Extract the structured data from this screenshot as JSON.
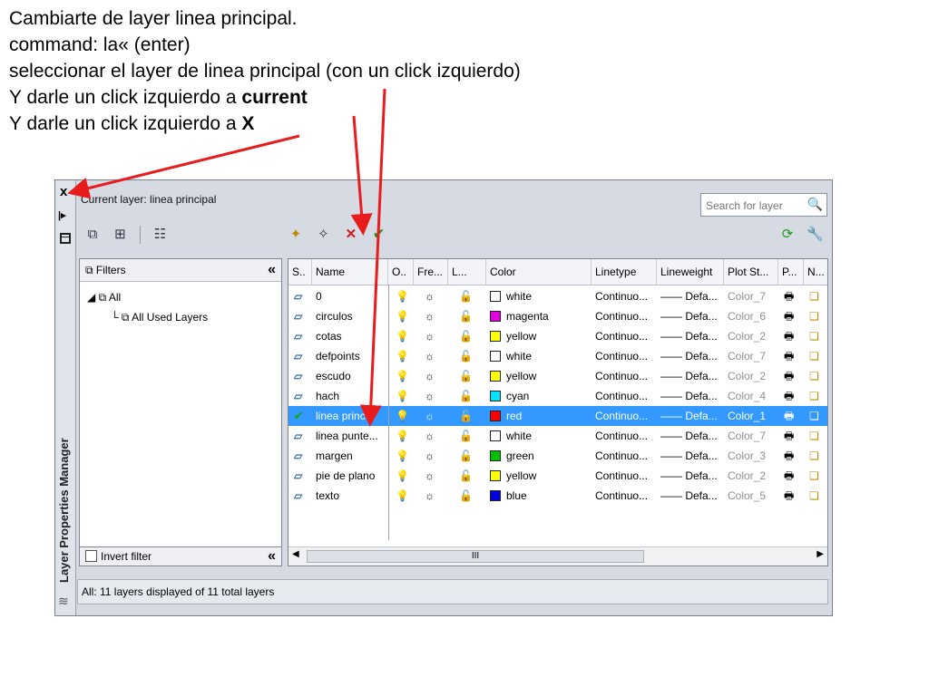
{
  "instructions": {
    "line1": "Cambiarte de layer linea principal.",
    "line2": "command: la« (enter)",
    "line3": "seleccionar el layer de linea principal  (con un click izquierdo)",
    "line4_prefix": "Y darle un click izquierdo a ",
    "line4_bold": "current",
    "line5_prefix": "Y darle un click izquierdo a ",
    "line5_bold": "X"
  },
  "palette": {
    "close_glyph": "x",
    "vertical_title": "Layer Properties Manager",
    "current_layer": "Current layer: linea principal",
    "search_placeholder": "Search for layer",
    "filters_header": "Filters",
    "tree_all": "All",
    "tree_used": "All Used Layers",
    "invert_filter": "Invert filter",
    "status": "All: 11 layers displayed of 11 total layers",
    "scroll_thumb": "III"
  },
  "columns": [
    "S..",
    "Name",
    "O..",
    "Fre...",
    "L...",
    "Color",
    "Linetype",
    "Lineweight",
    "Plot St...",
    "P...",
    "N..."
  ],
  "layers": [
    {
      "name": "0",
      "color": "white",
      "hex": "#ffffff",
      "linetype": "Continuo...",
      "lineweight": "Defa...",
      "plot": "Color_7"
    },
    {
      "name": "circulos",
      "color": "magenta",
      "hex": "#e000e0",
      "linetype": "Continuo...",
      "lineweight": "Defa...",
      "plot": "Color_6"
    },
    {
      "name": "cotas",
      "color": "yellow",
      "hex": "#ffff00",
      "linetype": "Continuo...",
      "lineweight": "Defa...",
      "plot": "Color_2"
    },
    {
      "name": "defpoints",
      "color": "white",
      "hex": "#ffffff",
      "linetype": "Continuo...",
      "lineweight": "Defa...",
      "plot": "Color_7"
    },
    {
      "name": "escudo",
      "color": "yellow",
      "hex": "#ffff00",
      "linetype": "Continuo...",
      "lineweight": "Defa...",
      "plot": "Color_2"
    },
    {
      "name": "hach",
      "color": "cyan",
      "hex": "#00e5ff",
      "linetype": "Continuo...",
      "lineweight": "Defa...",
      "plot": "Color_4"
    },
    {
      "name": "linea princ...",
      "color": "red",
      "hex": "#ff0000",
      "linetype": "Continuo...",
      "lineweight": "Defa...",
      "plot": "Color_1",
      "selected": true,
      "current": true
    },
    {
      "name": "linea punte...",
      "color": "white",
      "hex": "#ffffff",
      "linetype": "Continuo...",
      "lineweight": "Defa...",
      "plot": "Color_7"
    },
    {
      "name": "margen",
      "color": "green",
      "hex": "#00c000",
      "linetype": "Continuo...",
      "lineweight": "Defa...",
      "plot": "Color_3"
    },
    {
      "name": "pie de plano",
      "color": "yellow",
      "hex": "#ffff00",
      "linetype": "Continuo...",
      "lineweight": "Defa...",
      "plot": "Color_2"
    },
    {
      "name": "texto",
      "color": "blue",
      "hex": "#0000e0",
      "linetype": "Continuo...",
      "lineweight": "Defa...",
      "plot": "Color_5"
    }
  ],
  "colors": {
    "selection": "#3399ff",
    "arrow": "#e81c1c"
  }
}
